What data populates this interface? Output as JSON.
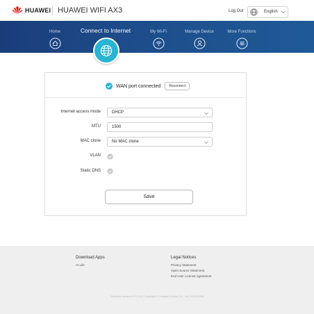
{
  "header": {
    "brand": "HUAWEI",
    "product": "HUAWEI WIFI AX3",
    "logout_label": "Log Out",
    "language": "English"
  },
  "nav": {
    "items": [
      {
        "label": "Home",
        "icon": "home-icon"
      },
      {
        "label": "Connect to Internet",
        "icon": "globe-icon",
        "active": true
      },
      {
        "label": "My Wi-Fi",
        "icon": "wifi-icon"
      },
      {
        "label": "Manage Device",
        "icon": "user-icon"
      },
      {
        "label": "More Functions",
        "icon": "menu-icon"
      }
    ]
  },
  "status": {
    "text": "WAN port connected",
    "reconnect_label": "Reconnect",
    "color": "#2ab4d4"
  },
  "form": {
    "access_mode_label": "Internet access mode",
    "access_mode_value": "DHCP",
    "mtu_label": "MTU",
    "mtu_value": "1500",
    "mac_label": "MAC clone",
    "mac_value": "No MAC clone",
    "vlan_label": "VLAN",
    "static_dns_label": "Static DNS",
    "save_label": "Save"
  },
  "footer": {
    "apps_heading": "Download Apps",
    "apps_link": "AI Life",
    "legal_heading": "Legal Notices",
    "legal_links": [
      "Privacy Statement",
      "Open Source Statement",
      "End User License Agreement"
    ],
    "copyright": "Software version:9.0.0.15 | Copyright © Huawei Device Co., Ltd. 2012-2020"
  },
  "colors": {
    "nav_band": "#1d4c8a",
    "accent": "#2ab4d4",
    "brand_red": "#e2231a"
  }
}
